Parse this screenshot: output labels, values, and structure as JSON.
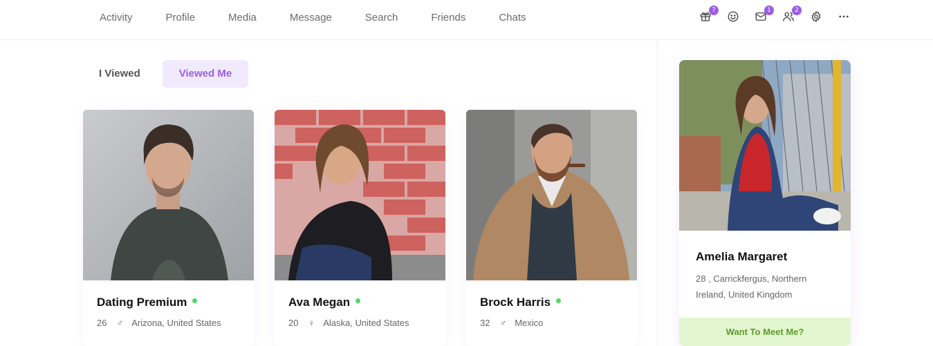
{
  "nav": {
    "tabs": [
      "Activity",
      "Profile",
      "Media",
      "Message",
      "Search",
      "Friends",
      "Chats"
    ],
    "icons": [
      {
        "name": "gift-icon",
        "badge": "7"
      },
      {
        "name": "smiley-icon",
        "badge": ""
      },
      {
        "name": "mail-icon",
        "badge": "1"
      },
      {
        "name": "friends-icon",
        "badge": "2"
      },
      {
        "name": "gear-icon",
        "badge": ""
      },
      {
        "name": "more-icon",
        "badge": ""
      }
    ]
  },
  "toggle": {
    "items": [
      "I Viewed",
      "Viewed Me"
    ],
    "active": "Viewed Me"
  },
  "cards": [
    {
      "name": "Dating Premium",
      "age": "26",
      "gender_icon": "male-icon",
      "location": "Arizona, United States",
      "online": true
    },
    {
      "name": "Ava Megan",
      "age": "20",
      "gender_icon": "female-icon",
      "location": "Alaska, United States",
      "online": true
    },
    {
      "name": "Brock Harris",
      "age": "32",
      "gender_icon": "male-icon",
      "location": "Mexico",
      "online": true
    }
  ],
  "side": {
    "name": "Amelia Margaret",
    "location_line1": "28 , Carrickfergus, Northern",
    "location_line2": "Ireland, United Kingdom",
    "cta": "Want To Meet Me?"
  },
  "colors": {
    "accent": "#9b5de5",
    "online": "#4cd964",
    "cta_bg": "#e2f7cf",
    "cta_text": "#5e9a2c"
  }
}
